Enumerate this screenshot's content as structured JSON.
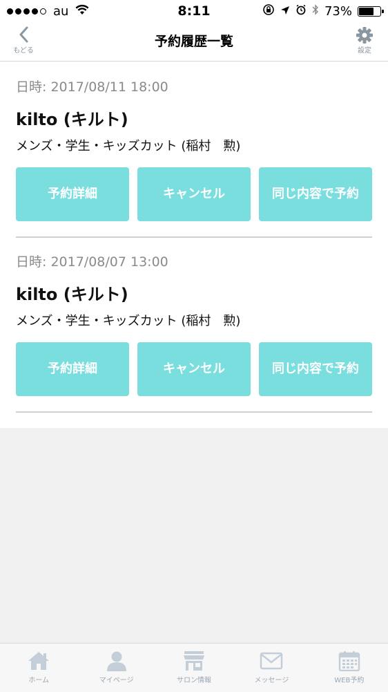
{
  "status_bar": {
    "carrier": "au",
    "time": "8:11",
    "battery_pct": "73%",
    "battery_level": 0.73
  },
  "nav": {
    "back_label": "もどる",
    "title": "予約履歴一覧",
    "settings_label": "設定"
  },
  "reservations": [
    {
      "date": "日時: 2017/08/11 18:00",
      "shop": "kilto (キルト)",
      "menu": "メンズ・学生・キッズカット (稲村　勲)",
      "detail_label": "予約詳細",
      "cancel_label": "キャンセル",
      "repeat_label": "同じ内容で予約"
    },
    {
      "date": "日時: 2017/08/07 13:00",
      "shop": "kilto (キルト)",
      "menu": "メンズ・学生・キッズカット (稲村　勲)",
      "detail_label": "予約詳細",
      "cancel_label": "キャンセル",
      "repeat_label": "同じ内容で予約"
    }
  ],
  "tabs": [
    {
      "label": "ホーム",
      "icon": "home-icon"
    },
    {
      "label": "マイページ",
      "icon": "person-icon"
    },
    {
      "label": "サロン情報",
      "icon": "shop-icon"
    },
    {
      "label": "メッセージ",
      "icon": "envelope-icon"
    },
    {
      "label": "WEB予約",
      "icon": "calendar-icon"
    }
  ],
  "colors": {
    "button": "#7adede",
    "tab_icon": "#c3ced8",
    "nav_icon": "#8a96a0"
  }
}
